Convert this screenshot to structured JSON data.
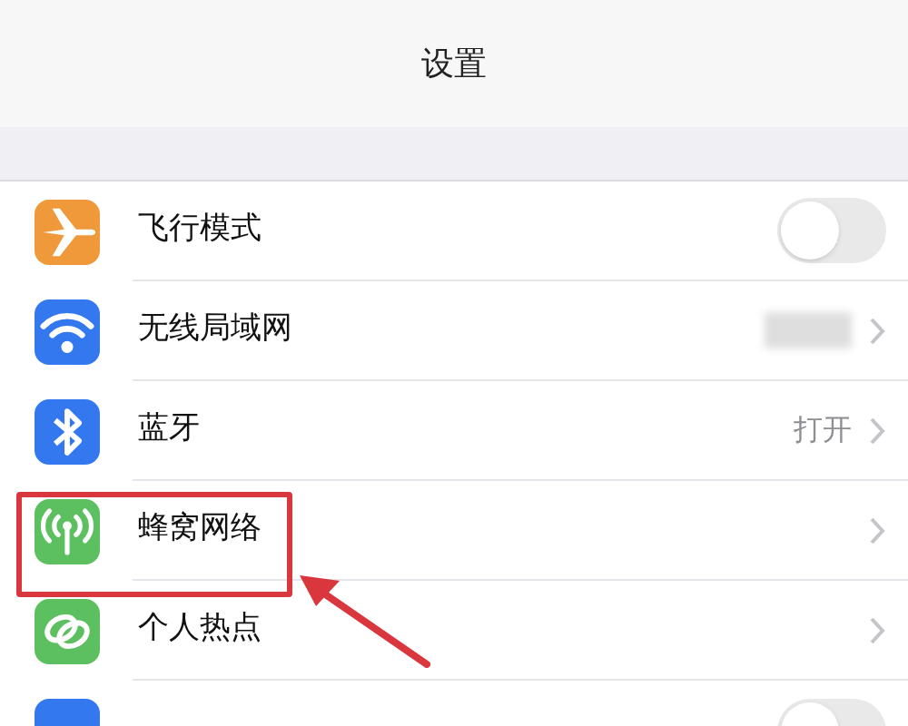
{
  "navigation_bar": {
    "title": "设置"
  },
  "settings": [
    {
      "kind": "toggle",
      "label": "飞行模式",
      "on": false,
      "color": "#f0993a"
    },
    {
      "kind": "hidden_value",
      "label": "无线局域网",
      "color": "#3478f0"
    },
    {
      "kind": "value",
      "label": "蓝牙",
      "value": "打开",
      "color": "#3478f0"
    },
    {
      "kind": "link",
      "label": "蜂窝网络",
      "color": "#5cbf60"
    },
    {
      "kind": "link",
      "label": "个人热点",
      "color": "#5cbf60"
    },
    {
      "kind": "toggle",
      "on": false,
      "color": "#3478f0"
    }
  ]
}
